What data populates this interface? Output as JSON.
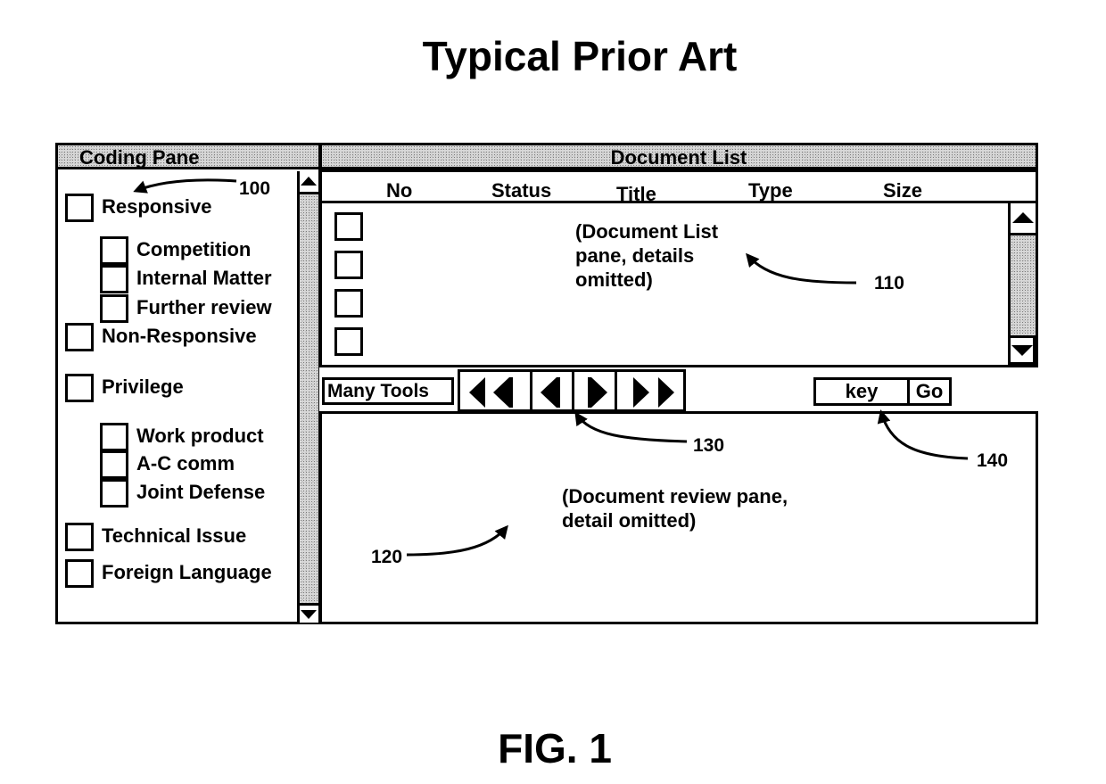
{
  "figure": {
    "title": "Typical Prior Art",
    "label": "FIG. 1"
  },
  "coding_pane": {
    "header": "Coding Pane",
    "ref": "100",
    "items": [
      {
        "label": "Responsive",
        "level": 0
      },
      {
        "label": "Competition",
        "level": 1
      },
      {
        "label": "Internal Matter",
        "level": 1
      },
      {
        "label": "Further review",
        "level": 1
      },
      {
        "label": "Non-Responsive",
        "level": 0
      },
      {
        "label": "Privilege",
        "level": 0
      },
      {
        "label": "Work product",
        "level": 1
      },
      {
        "label": "A-C comm",
        "level": 1
      },
      {
        "label": "Joint Defense",
        "level": 1
      },
      {
        "label": "Technical Issue",
        "level": 0
      },
      {
        "label": "Foreign Language",
        "level": 0
      }
    ]
  },
  "document_list": {
    "header": "Document List",
    "columns": [
      "No",
      "Status",
      "Title",
      "Type",
      "Size"
    ],
    "row_count": 4,
    "note": [
      "(Document List",
      "pane, details",
      "omitted)"
    ],
    "ref": "110"
  },
  "toolbar": {
    "many_tools_label": "Many Tools",
    "nav_buttons": [
      "first-page",
      "previous-page",
      "next-page",
      "last-page"
    ],
    "nav_ref": "130",
    "search_value": "key",
    "go_label": "Go",
    "search_ref": "140"
  },
  "review_pane": {
    "note": [
      "(Document review pane,",
      "detail omitted)"
    ],
    "ref": "120"
  }
}
